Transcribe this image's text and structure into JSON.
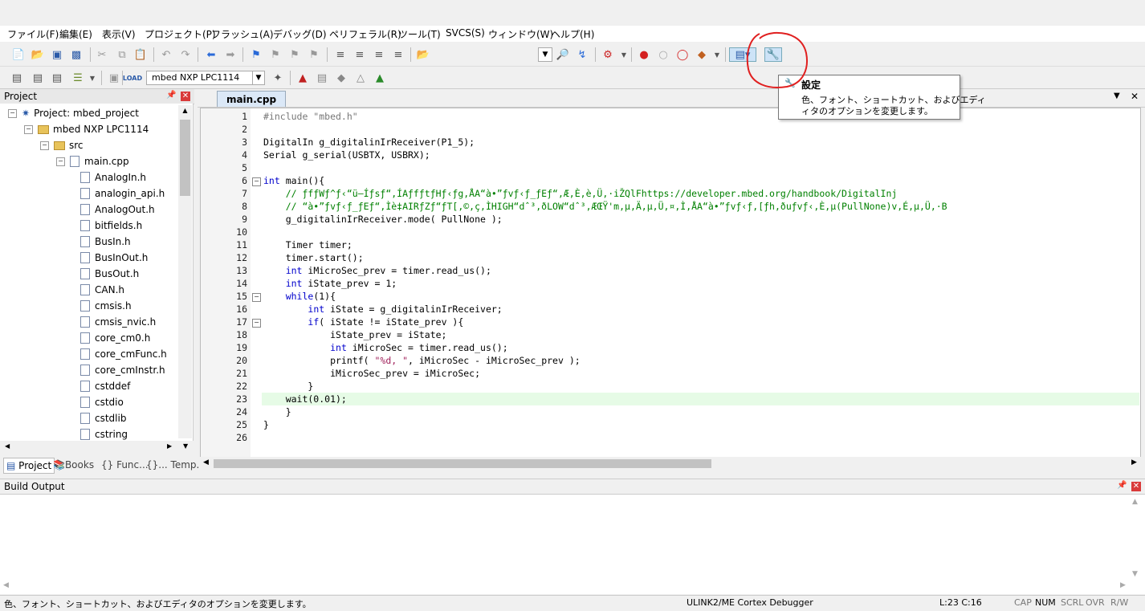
{
  "menu": [
    "ファイル(F)",
    "編集(E)",
    "表示(V)",
    "プロジェクト(P)",
    "フラッシュ(A)",
    "デバッグ(D)",
    "ペリフェラル(R)",
    "ツール(T)",
    "SVCS(S)",
    "ウィンドウ(W)",
    "ヘルプ(H)"
  ],
  "toolbar2": {
    "target": "mbed NXP LPC1114",
    "load_label": "LOAD"
  },
  "project_panel": {
    "title": "Project",
    "tree": [
      {
        "label": "Project: mbed_project",
        "depth": 0,
        "kind": "project"
      },
      {
        "label": "mbed NXP LPC1114",
        "depth": 1,
        "kind": "target"
      },
      {
        "label": "src",
        "depth": 2,
        "kind": "folder"
      },
      {
        "label": "main.cpp",
        "depth": 3,
        "kind": "file"
      },
      {
        "label": "AnalogIn.h",
        "depth": 4,
        "kind": "file"
      },
      {
        "label": "analogin_api.h",
        "depth": 4,
        "kind": "file"
      },
      {
        "label": "AnalogOut.h",
        "depth": 4,
        "kind": "file"
      },
      {
        "label": "bitfields.h",
        "depth": 4,
        "kind": "file"
      },
      {
        "label": "BusIn.h",
        "depth": 4,
        "kind": "file"
      },
      {
        "label": "BusInOut.h",
        "depth": 4,
        "kind": "file"
      },
      {
        "label": "BusOut.h",
        "depth": 4,
        "kind": "file"
      },
      {
        "label": "CAN.h",
        "depth": 4,
        "kind": "file"
      },
      {
        "label": "cmsis.h",
        "depth": 4,
        "kind": "file"
      },
      {
        "label": "cmsis_nvic.h",
        "depth": 4,
        "kind": "file"
      },
      {
        "label": "core_cm0.h",
        "depth": 4,
        "kind": "file"
      },
      {
        "label": "core_cmFunc.h",
        "depth": 4,
        "kind": "file"
      },
      {
        "label": "core_cmInstr.h",
        "depth": 4,
        "kind": "file"
      },
      {
        "label": "cstddef",
        "depth": 4,
        "kind": "file"
      },
      {
        "label": "cstdio",
        "depth": 4,
        "kind": "file"
      },
      {
        "label": "cstdlib",
        "depth": 4,
        "kind": "file"
      },
      {
        "label": "cstring",
        "depth": 4,
        "kind": "file"
      }
    ],
    "tabs": [
      "Project",
      "Books",
      "{} Func...",
      "{}... Temp..."
    ]
  },
  "editor": {
    "tab": "main.cpp",
    "lines": [
      "#include \"mbed.h\"",
      "",
      "DigitalIn g_digitalinIrReceiver(P1_5);",
      "Serial g_serial(USBTX, USBRX);",
      "",
      "int main(){",
      "    // ƒfƒWƒ^ƒ‹“ü—Íƒsƒ“,ÍAƒfƒtƒHƒ‹ƒg,ÅA“à•”ƒvƒ‹ƒ_ƒEƒ“,Æ,È,è,Ü,·iŽQlFhttps://developer.mbed.org/handbook/DigitalInj",
      "    // “à•”ƒvƒ‹ƒ_ƒEƒ“,Ìè‡AIRƒZƒ“ƒT[,©,ç,ÌHIGH“dˆ³,ðLOW“dˆ³,ÆŒŸ'm,µ,Ä,µ,Ü,¤,Ì,ÅA“à•”ƒvƒ‹ƒ,[ƒh,ðuƒvƒ‹,È,µ(PullNone)v,É,µ,Ü,·B",
      "    g_digitalinIrReceiver.mode( PullNone );",
      "",
      "    Timer timer;",
      "    timer.start();",
      "    int iMicroSec_prev = timer.read_us();",
      "    int iState_prev = 1;",
      "    while(1){",
      "        int iState = g_digitalinIrReceiver;",
      "        if( iState != iState_prev ){",
      "            iState_prev = iState;",
      "            int iMicroSec = timer.read_us();",
      "            printf( \"%d, \", iMicroSec - iMicroSec_prev );",
      "            iMicroSec_prev = iMicroSec;",
      "        }",
      "    wait(0.01);",
      "    }",
      "}",
      ""
    ],
    "current_line": 23
  },
  "tooltip": {
    "title": "設定",
    "body1": "色、フォント、ショートカット、およびエディ",
    "body2": "ィタのオプションを変更します。"
  },
  "build_output": {
    "title": "Build Output"
  },
  "status": {
    "message": "色、フォント、ショートカット、およびエディタのオプションを変更します。",
    "debugger": "ULINK2/ME Cortex Debugger",
    "position": "L:23 C:16",
    "indicators": [
      "CAP",
      "NUM",
      "SCRL",
      "OVR",
      "R/W"
    ]
  },
  "colors": {
    "keyword": "#0000cc",
    "comment": "#008000",
    "highlight_line": "#e6fbe6",
    "annotation": "#e02020"
  }
}
